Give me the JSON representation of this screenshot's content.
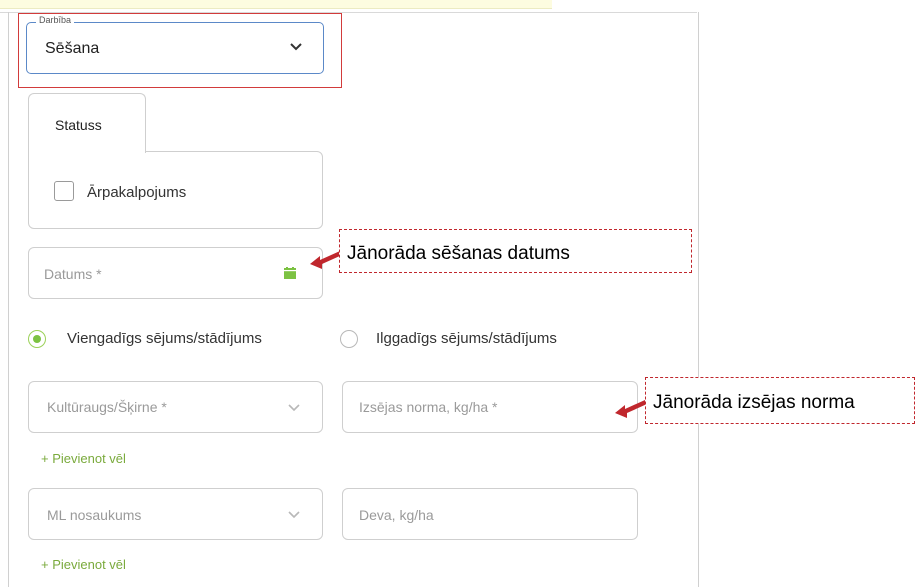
{
  "activity": {
    "legend": "Darbība",
    "value": "Sēšana"
  },
  "tabs": [
    {
      "label": "Statuss"
    }
  ],
  "status": {
    "outsourcing_label": "Ārpakalpojums",
    "outsourcing_checked": false
  },
  "date": {
    "placeholder": "Datums *",
    "callout": "Jānorāda sēšanas datums"
  },
  "sowing_type": {
    "options": [
      {
        "label": "Viengadīgs sējums/stādījums",
        "selected": true
      },
      {
        "label": "Ilggadīgs sējums/stādījums",
        "selected": false
      }
    ]
  },
  "crop": {
    "crop_placeholder": "Kultūraugs/Šķirne *",
    "rate_placeholder": "Izsējas norma, kg/ha *",
    "callout": "Jānorāda izsējas norma",
    "add_more": "+ Pievienot vēl"
  },
  "fertilizer": {
    "name_placeholder": "ML nosaukums",
    "dose_placeholder": "Deva, kg/ha",
    "add_more": "+ Pievienot vēl"
  },
  "colors": {
    "accent": "#7cc242",
    "focus_border": "#5b89c8",
    "annotation": "#c0272d"
  },
  "icons": [
    "chevron-down-icon",
    "calendar-icon",
    "arrow-left-icon"
  ]
}
